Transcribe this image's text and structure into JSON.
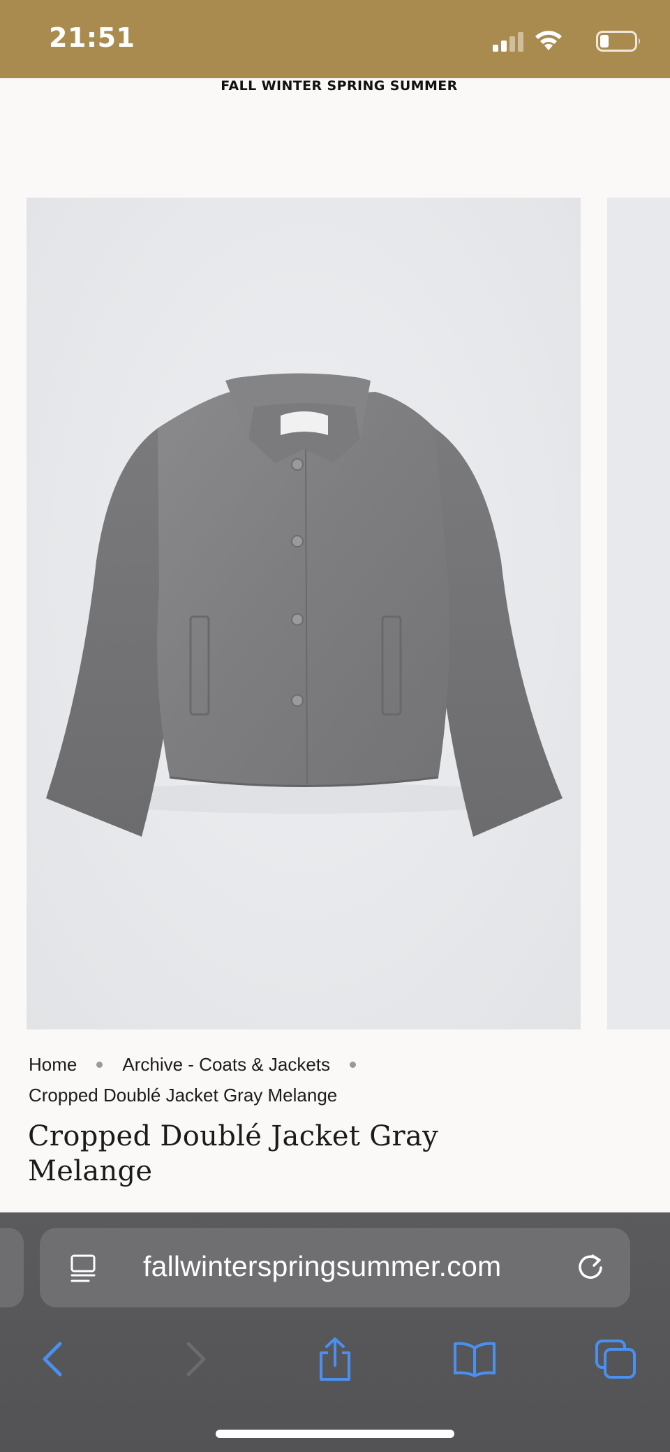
{
  "status_bar": {
    "time": "21:51",
    "icons": [
      "signal-icon",
      "wifi-icon",
      "battery-icon"
    ],
    "background": "#a98b50"
  },
  "brand": {
    "name": "FALL WINTER SPRING SUMMER"
  },
  "product_image": {
    "subject": "jacket-photo",
    "background": "#e6e8eb"
  },
  "breadcrumb": {
    "items": [
      "Home",
      "Archive - Coats & Jackets",
      "Cropped Doublé Jacket Gray Melange"
    ]
  },
  "product": {
    "title": "Cropped Doublé Jacket Gray Melange"
  },
  "browser": {
    "url": "fallwinterspringsummer.com",
    "icons": [
      "page-menu-icon",
      "reload-icon",
      "back-icon",
      "forward-icon",
      "share-icon",
      "bookmarks-icon",
      "tabs-icon"
    ],
    "accent": "#4a90f0"
  }
}
